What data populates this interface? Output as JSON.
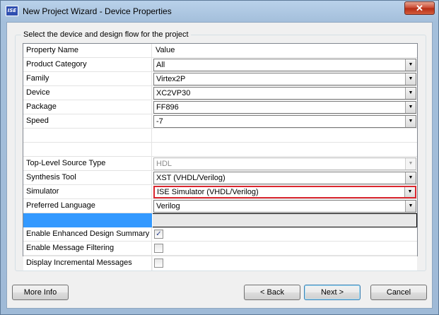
{
  "window": {
    "title": "New Project Wizard - Device Properties",
    "app_icon_text": "ISE",
    "close_glyph": "✕"
  },
  "group": {
    "label": "Select the device and design flow for the project"
  },
  "grid": {
    "header": {
      "name": "Property Name",
      "value": "Value"
    },
    "device_rows": [
      {
        "name": "Product Category",
        "value": "All"
      },
      {
        "name": "Family",
        "value": "Virtex2P"
      },
      {
        "name": "Device",
        "value": "XC2VP30"
      },
      {
        "name": "Package",
        "value": "FF896"
      },
      {
        "name": "Speed",
        "value": "-7"
      }
    ],
    "flow_rows": [
      {
        "name": "Top-Level Source Type",
        "value": "HDL",
        "state": "disabled"
      },
      {
        "name": "Synthesis Tool",
        "value": "XST (VHDL/Verilog)"
      },
      {
        "name": "Simulator",
        "value": "ISE Simulator (VHDL/Verilog)",
        "state": "highlighted",
        "highlight_color": "#d9262e"
      },
      {
        "name": "Preferred Language",
        "value": "Verilog"
      }
    ],
    "option_rows": [
      {
        "name": "Enable Enhanced Design Summary",
        "checked": true
      },
      {
        "name": "Enable Message Filtering",
        "checked": false
      },
      {
        "name": "Display Incremental Messages",
        "checked": false
      }
    ],
    "selection_color": "#3399ff"
  },
  "buttons": {
    "more_info": "More Info",
    "back": "< Back",
    "next": "Next >",
    "cancel": "Cancel"
  },
  "icons": {
    "dropdown": "chevron-down-icon",
    "check": "checkmark-icon"
  }
}
